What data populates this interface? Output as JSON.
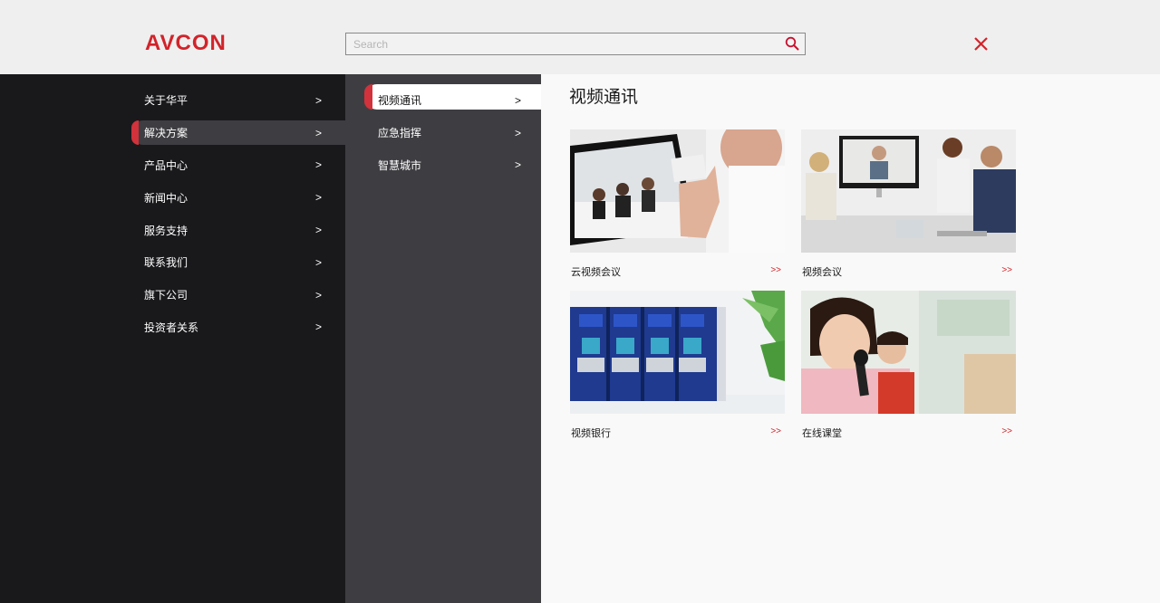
{
  "brand": {
    "logo_text": "AVCON",
    "accent": "#d2232a"
  },
  "search": {
    "placeholder": "Search"
  },
  "nav": {
    "items": [
      {
        "label": "关于华平",
        "chevron": ">"
      },
      {
        "label": "解决方案",
        "chevron": ">"
      },
      {
        "label": "产品中心",
        "chevron": ">"
      },
      {
        "label": "新闻中心",
        "chevron": ">"
      },
      {
        "label": "服务支持",
        "chevron": ">"
      },
      {
        "label": "联系我们",
        "chevron": ">"
      },
      {
        "label": "旗下公司",
        "chevron": ">"
      },
      {
        "label": "投资者关系",
        "chevron": ">"
      }
    ]
  },
  "subnav": {
    "items": [
      {
        "label": "视频通讯",
        "chevron": ">"
      },
      {
        "label": "应急指挥",
        "chevron": ">"
      },
      {
        "label": "智慧城市",
        "chevron": ">"
      }
    ]
  },
  "content": {
    "title": "视频通讯",
    "cards": [
      {
        "caption": "云视频会议",
        "more": ">>"
      },
      {
        "caption": "视频会议",
        "more": ">>"
      },
      {
        "caption": "视频银行",
        "more": ">>"
      },
      {
        "caption": "在线课堂",
        "more": ">>"
      }
    ]
  }
}
